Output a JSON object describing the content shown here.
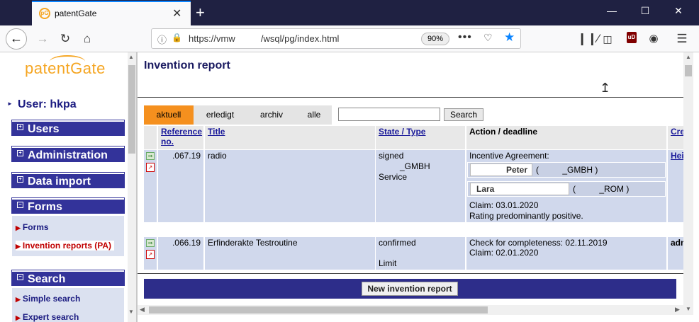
{
  "browser": {
    "tab_title": "patentGate",
    "tab_close": "✕",
    "new_tab": "+",
    "window": {
      "minimize": "—",
      "maximize": "☐",
      "close": "✕"
    },
    "url": "https://vmw          /wsql/pg/index.html",
    "zoom": "90%",
    "icons": [
      "back-icon",
      "forward-icon",
      "reload-icon",
      "home-icon",
      "info-icon",
      "lock-icon",
      "page-actions-icon",
      "pocket-icon",
      "bookmark-star-icon",
      "library-icon",
      "sidebar-icon",
      "ublock-icon",
      "account-icon",
      "menu-icon"
    ],
    "ublock_label": "uD"
  },
  "sidebar": {
    "logo": "patentGate",
    "user_label": "User: hkpa",
    "sections": [
      {
        "label": "Users"
      },
      {
        "label": "Administration"
      },
      {
        "label": "Data import"
      },
      {
        "label": "Forms"
      },
      {
        "label": "Search"
      }
    ],
    "forms_links": [
      "Forms",
      "Invention reports (PA)"
    ],
    "search_links": [
      "Simple search",
      "Expert search"
    ]
  },
  "main": {
    "title": "Invention report",
    "filter_tabs": [
      "aktuell",
      "erledigt",
      "archiv",
      "alle"
    ],
    "search_value": "",
    "search_button": "Search",
    "columns": {
      "reference": "Reference no.",
      "title": "Title",
      "state": "State / Type",
      "action": "Action / deadline",
      "creator": "Cre"
    },
    "rows": [
      {
        "reference": ".067.19",
        "title": "radio",
        "state": [
          "signed",
          "_GMBH",
          "Service"
        ],
        "action_label": "Incentive Agreement:",
        "persons": [
          {
            "name": "Peter",
            "org": "(          _GMBH )"
          },
          {
            "name": "Lara",
            "org": "(          _ROM )"
          }
        ],
        "claim": "Claim: 03.01.2020",
        "rating": "Rating predominantly positive.",
        "creator": "Heil"
      },
      {
        "reference": ".066.19",
        "title": "Erfinderakte Testroutine",
        "state": [
          "confirmed",
          "Limit"
        ],
        "action_lines": [
          "Check for completeness: 02.11.2019",
          "Claim: 02.01.2020"
        ],
        "creator": "adm"
      }
    ],
    "new_button": "New invention report"
  },
  "colors": {
    "accent_orange": "#f5901e",
    "nav_blue": "#33339a",
    "row_bg": "#d0d8ec",
    "brand": "#f5a623"
  }
}
